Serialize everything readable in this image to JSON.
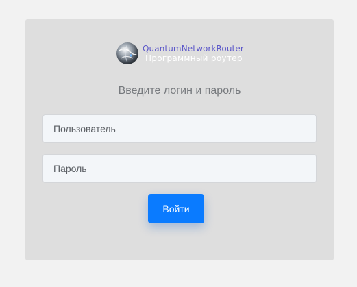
{
  "brand": {
    "name": "QuantumNetworkRouter",
    "subtitle": "Программный роутер",
    "logo_icon": "globe-logo-icon"
  },
  "form": {
    "prompt": "Введите логин и пароль",
    "username_placeholder": "Пользователь",
    "password_placeholder": "Пароль",
    "submit_label": "Войти"
  },
  "colors": {
    "page_background": "#f2f2f2",
    "card_background": "#dedede",
    "brand_name": "#5d59c9",
    "button": "#0a7bff"
  }
}
